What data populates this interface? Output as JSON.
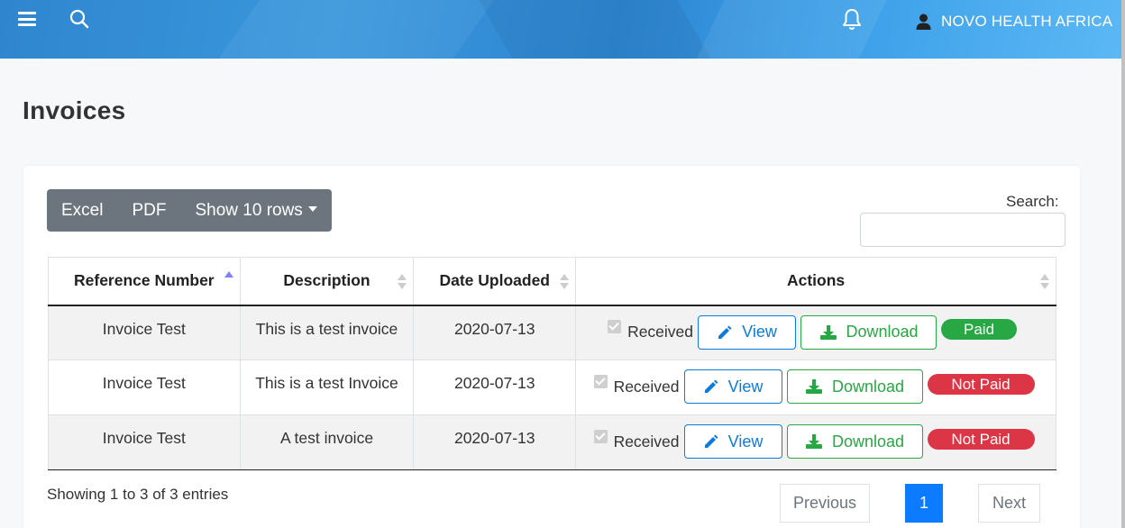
{
  "header": {
    "user_name": "NOVO HEALTH AFRICA",
    "icons": [
      "menu-icon",
      "search-icon",
      "bell-icon",
      "user-icon"
    ]
  },
  "page": {
    "title": "Invoices"
  },
  "toolbar": {
    "excel_label": "Excel",
    "pdf_label": "PDF",
    "rows_label": "Show 10 rows"
  },
  "search": {
    "label": "Search:",
    "value": ""
  },
  "table": {
    "columns": [
      "Reference Number",
      "Description",
      "Date Uploaded",
      "Actions"
    ],
    "sort_column": "Reference Number",
    "rows": [
      {
        "reference": "Invoice Test",
        "description": "This is a test invoice",
        "date": "2020-07-13",
        "received": "Received",
        "view": "View",
        "download": "Download",
        "status": "Paid"
      },
      {
        "reference": "Invoice Test",
        "description": "This is a test Invoice",
        "date": "2020-07-13",
        "received": "Received",
        "view": "View",
        "download": "Download",
        "status": "Not Paid"
      },
      {
        "reference": "Invoice Test",
        "description": "A test invoice",
        "date": "2020-07-13",
        "received": "Received",
        "view": "View",
        "download": "Download",
        "status": "Not Paid"
      }
    ]
  },
  "footer": {
    "info": "Showing 1 to 3 of 3 entries",
    "previous": "Previous",
    "current_page": "1",
    "next": "Next"
  },
  "colors": {
    "primary": "#0d7bdc",
    "success": "#28a745",
    "danger": "#dc3545",
    "secondary": "#6c757d"
  }
}
